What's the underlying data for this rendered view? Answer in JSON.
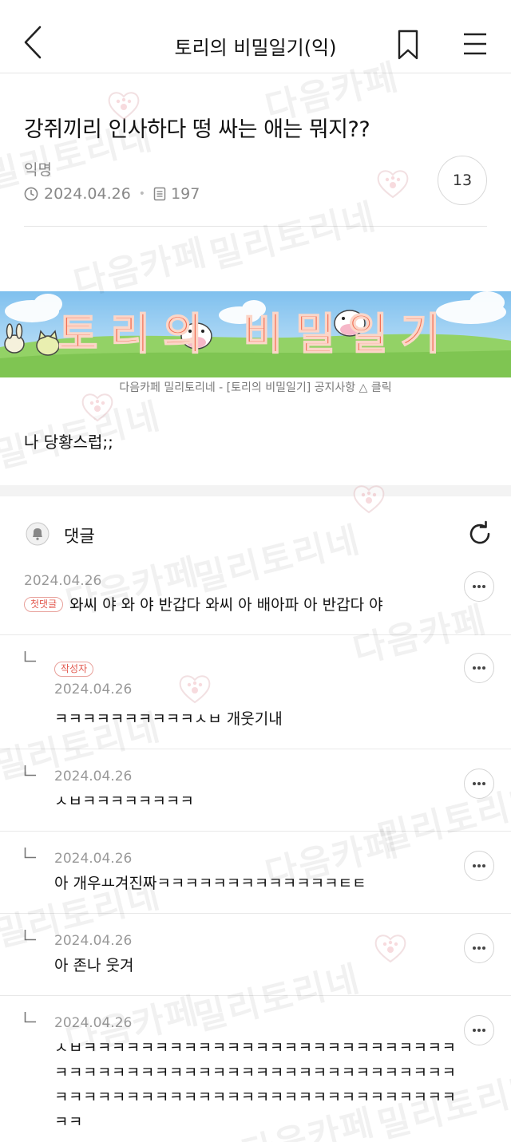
{
  "topbar": {
    "cafe_title": "토리의 비밀일기(익)",
    "icons": [
      "back-arrow-icon",
      "bookmark-icon",
      "hamburger-menu-icon"
    ]
  },
  "post": {
    "title": "강쥐끼리 인사하다 떵 싸는 애는 뭐지??",
    "author": "익명",
    "date": "2024.04.26",
    "views": "197",
    "comment_count": "13",
    "banner_title": "토리의 비밀일기",
    "banner_caption": "다음카페 밀리토리네 - [토리의 비밀일기] 공지사항 △ 클릭",
    "body": "나 당황스럽;;"
  },
  "comments_section": {
    "label": "댓글",
    "items": [
      {
        "date": "2024.04.26",
        "badge": "첫댓글",
        "text": "와씨 야 와 야 반갑다 와씨 아 배아파 아 반갑다 야",
        "reply": false
      },
      {
        "date": "2024.04.26",
        "badge": "작성자",
        "text": "ㅋㅋㅋㅋㅋㅋㅋㅋㅋㅋㅅㅂ 개웃기내",
        "reply": true
      },
      {
        "date": "2024.04.26",
        "text": "ㅅㅂㅋㅋㅋㅋㅋㅋㅋㅋ",
        "reply": true
      },
      {
        "date": "2024.04.26",
        "text": "아 개우ㅛ겨진짜ㅋㅋㅋㅋㅋㅋㅋㅋㅋㅋㅋㅋㅋㅌㅌ",
        "reply": true
      },
      {
        "date": "2024.04.26",
        "text": "아 존나 웃겨",
        "reply": true
      },
      {
        "date": "2024.04.26",
        "text": "ㅅㅂㅋㅋㅋㅋㅋㅋㅋㅋㅋㅋㅋㅋㅋㅋㅋㅋㅋㅋㅋㅋㅋㅋㅋㅋㅋㅋㅋㅋㅋㅋㅋㅋㅋㅋㅋㅋㅋㅋㅋㅋㅋㅋㅋㅋㅋㅋㅋㅋㅋㅋㅋㅋㅋㅋㅋㅋㅋㅋㅋㅋㅋㅋㅋㅋㅋㅋㅋㅋㅋㅋㅋㅋㅋㅋㅋㅋㅋㅋㅋㅋㅋㅋㅋㅋ",
        "reply": true
      }
    ]
  },
  "watermark": {
    "text_a": "다음카페",
    "text_b": "밀리토리네"
  },
  "colors": {
    "accent_red": "#e2584e",
    "meta_gray": "#888888",
    "divider": "#e8e8e8",
    "sky": "#8ec8ef",
    "grass": "#8fcf5b"
  }
}
